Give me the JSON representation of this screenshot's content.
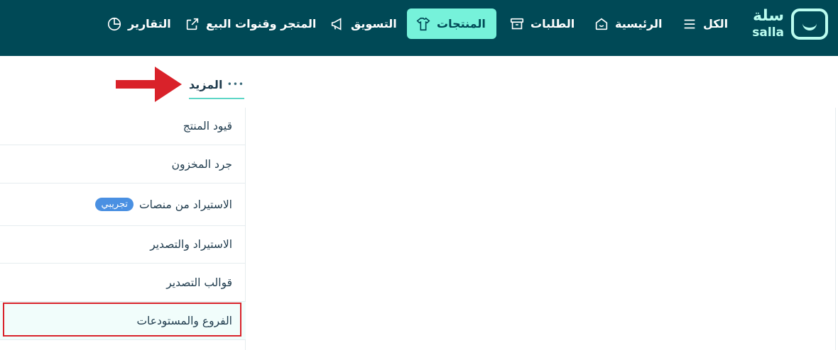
{
  "brand": {
    "name_ar": "سلة",
    "name_en": "salla"
  },
  "nav": {
    "items": [
      {
        "label": "الكل",
        "icon": "menu-icon"
      },
      {
        "label": "الرئيسية",
        "icon": "home-icon"
      },
      {
        "label": "الطلبات",
        "icon": "archive-box-icon"
      },
      {
        "label": "المنتجات",
        "icon": "shirt-icon",
        "active": true
      },
      {
        "label": "التسويق",
        "icon": "megaphone-icon"
      },
      {
        "label": "المتجر وقنوات البيع",
        "icon": "store-arrow-icon"
      },
      {
        "label": "التقارير",
        "icon": "pie-chart-icon"
      }
    ]
  },
  "more_tab": {
    "label": "المزيد",
    "dots": "•••"
  },
  "menu": {
    "items": [
      {
        "label": "قيود المنتج"
      },
      {
        "label": "جرد المخزون"
      },
      {
        "label": "الاستيراد من منصات",
        "badge": "تجريبي"
      },
      {
        "label": "الاستيراد والتصدير"
      },
      {
        "label": "قوالب التصدير"
      },
      {
        "label": "الفروع والمستودعات",
        "highlighted": true
      }
    ]
  },
  "colors": {
    "topbar": "#004956",
    "active_tab": "#76f2da",
    "badge": "#4a90e2",
    "annotation_red": "#d9222a"
  }
}
